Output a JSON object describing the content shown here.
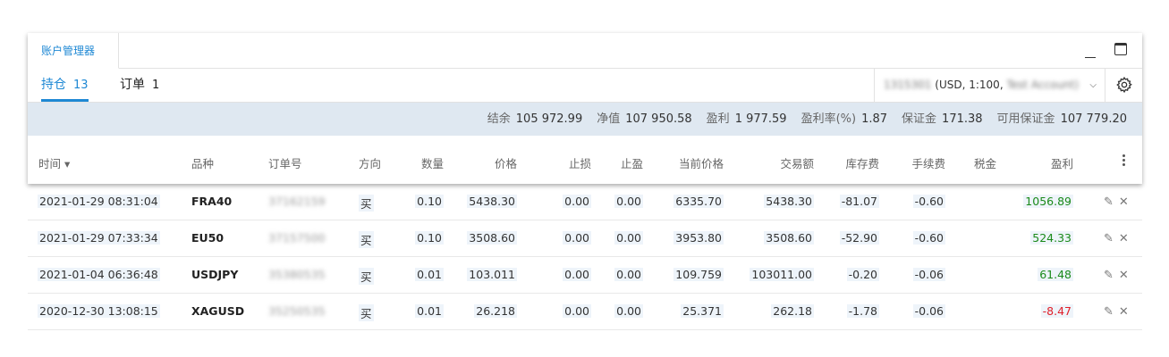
{
  "window": {
    "account_tab": "账户管理器"
  },
  "tabs": {
    "positions": {
      "label": "持仓",
      "count": "13"
    },
    "orders": {
      "label": "订单",
      "count": "1"
    }
  },
  "account": {
    "id": "1315301",
    "details": "(USD, 1:100,",
    "name": "Test Account)"
  },
  "summary": [
    {
      "label": "结余",
      "value": "105 972.99"
    },
    {
      "label": "净值",
      "value": "107 950.58"
    },
    {
      "label": "盈利",
      "value": "1 977.59"
    },
    {
      "label": "盈利率(%)",
      "value": "1.87"
    },
    {
      "label": "保证金",
      "value": "171.38"
    },
    {
      "label": "可用保证金",
      "value": "107 779.20"
    }
  ],
  "columns": [
    "时间 ▾",
    "品种",
    "订单号",
    "方向",
    "数量",
    "价格",
    "止损",
    "止盈",
    "当前价格",
    "交易额",
    "库存费",
    "手续费",
    "税金",
    "盈利"
  ],
  "rows": [
    {
      "time": "2021-01-29 08:31:04",
      "symbol": "FRA40",
      "ticket": "37162159",
      "side": "买",
      "qty": "0.10",
      "price": "5438.30",
      "sl": "0.00",
      "tp": "0.00",
      "current": "6335.70",
      "amount": "5438.30",
      "swap": "-81.07",
      "fee": "-0.60",
      "tax": "",
      "profit": "1056.89",
      "profit_sign": "pos"
    },
    {
      "time": "2021-01-29 07:33:34",
      "symbol": "EU50",
      "ticket": "37157500",
      "side": "买",
      "qty": "0.10",
      "price": "3508.60",
      "sl": "0.00",
      "tp": "0.00",
      "current": "3953.80",
      "amount": "3508.60",
      "swap": "-52.90",
      "fee": "-0.60",
      "tax": "",
      "profit": "524.33",
      "profit_sign": "pos"
    },
    {
      "time": "2021-01-04 06:36:48",
      "symbol": "USDJPY",
      "ticket": "35380535",
      "side": "买",
      "qty": "0.01",
      "price": "103.011",
      "sl": "0.00",
      "tp": "0.00",
      "current": "109.759",
      "amount": "103011.00",
      "swap": "-0.20",
      "fee": "-0.06",
      "tax": "",
      "profit": "61.48",
      "profit_sign": "pos"
    },
    {
      "time": "2020-12-30 13:08:15",
      "symbol": "XAGUSD",
      "ticket": "35250535",
      "side": "买",
      "qty": "0.01",
      "price": "26.218",
      "sl": "0.00",
      "tp": "0.00",
      "current": "25.371",
      "amount": "262.18",
      "swap": "-1.78",
      "fee": "-0.06",
      "tax": "",
      "profit": "-8.47",
      "profit_sign": "neg"
    }
  ],
  "colors": {
    "accent": "#1e88d4",
    "summary_bg": "#dfe8f1",
    "profit_pos": "#1a8a1a",
    "profit_neg": "#e0202a"
  },
  "icons": {
    "edit": "pencil-icon",
    "close": "close-icon",
    "settings": "gear-icon",
    "more": "vertical-dots-icon"
  }
}
